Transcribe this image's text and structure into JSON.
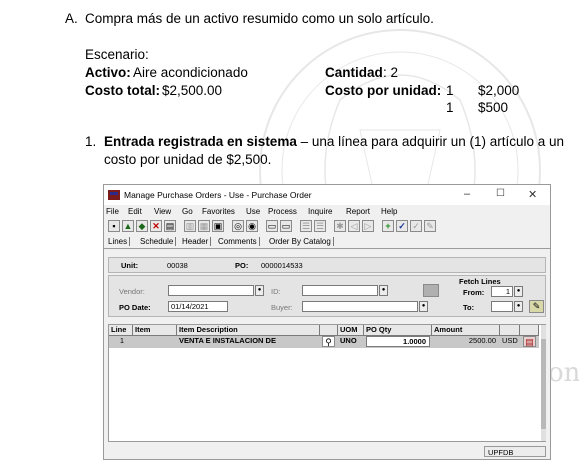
{
  "section": {
    "letter": "A.",
    "title": "Compra más de un activo resumido como un solo artículo."
  },
  "scenario": {
    "heading": "Escenario:",
    "asset_label": "Activo:",
    "asset_value": "Aire acondicionado",
    "total_label": "Costo total:",
    "total_value": "$2,500.00",
    "qty_label": "Cantidad",
    "qty_value": ": 2",
    "unit_cost_label": "Costo por unidad:",
    "unit_rows": [
      {
        "qty": "1",
        "amount": "$2,000"
      },
      {
        "qty": "1",
        "amount": "$500"
      }
    ]
  },
  "step": {
    "number": "1.",
    "bold": "Entrada registrada en sistema",
    "text_line1": " – una línea para adquirir un (1) artículo a un",
    "text_line2": "costo por unidad de $2,500."
  },
  "window": {
    "title": "Manage Purchase Orders - Use - Purchase Order",
    "controls": {
      "minimize": "–",
      "maximize": "☐",
      "close": "✕"
    },
    "menu": [
      "File",
      "Edit",
      "View",
      "Go",
      "Favorites",
      "Use",
      "Process",
      "Inquire",
      "Report",
      "Help"
    ],
    "tabs": [
      "Lines",
      "Schedule",
      "Header",
      "Comments",
      "Order By Catalog"
    ],
    "header": {
      "unit_label": "Unit:",
      "unit_value": "00038",
      "po_label": "PO:",
      "po_value": "0000014533"
    },
    "fields": {
      "vendor_label": "Vendor:",
      "vendor_value": "",
      "id_label": "ID:",
      "id_value": "",
      "po_date_label": "PO Date:",
      "po_date_value": "01/14/2021",
      "buyer_label": "Buyer:",
      "buyer_value": ""
    },
    "fetch": {
      "title": "Fetch Lines",
      "from_label": "From:",
      "from_value": "1",
      "to_label": "To:",
      "to_value": ""
    },
    "grid": {
      "columns": [
        "Line",
        "Item",
        "Item Description",
        "",
        "UOM",
        "PO Qty",
        "Amount",
        "",
        ""
      ],
      "rows": [
        {
          "line": "1",
          "item": "",
          "description": "VENTA E INSTALACION DE",
          "uom": "UNO",
          "qty": "1.0000",
          "amount": "2500.00",
          "currency": "USD"
        }
      ]
    },
    "status": "UPFDB"
  },
  "colors": {
    "grid_row": "#c8c8c8",
    "title_bg": "#ffffff",
    "window_bg": "#f0f0f0"
  }
}
